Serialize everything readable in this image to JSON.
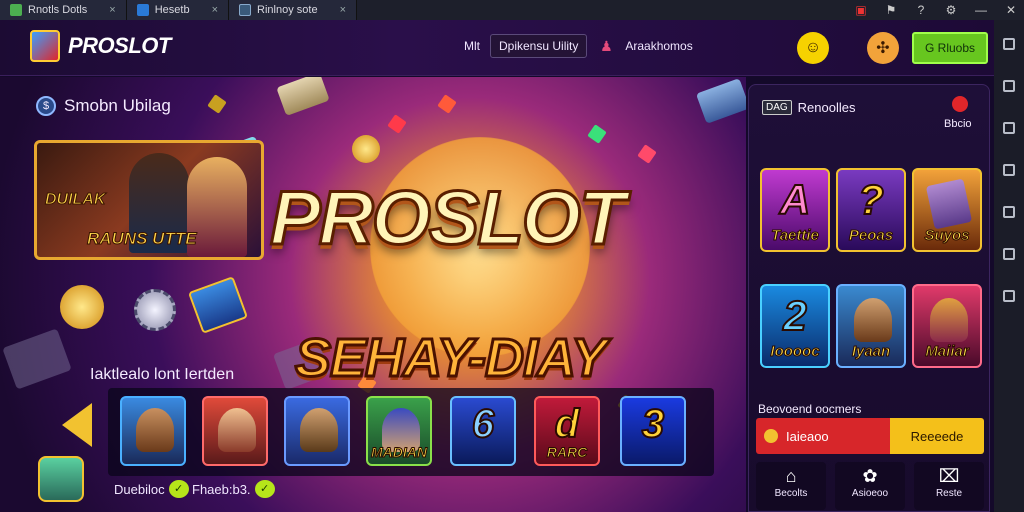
{
  "window": {
    "tabs": [
      {
        "label": "Rnotls Dotls",
        "icon": "folder-icon"
      },
      {
        "label": "Hesetb",
        "icon": "window-icon"
      },
      {
        "label": "Rinlnoy sote",
        "icon": "document-icon"
      }
    ],
    "controls": [
      "record-icon",
      "flag-icon",
      "help-icon",
      "gear-icon",
      "minimize-icon",
      "close-icon"
    ]
  },
  "header": {
    "logo": "PROSLOT",
    "nav_link": "Mlt",
    "nav_button": "Dpikensu Uility",
    "nav_account": "Araakhomos",
    "cta": "G Rluobs"
  },
  "hero": {
    "title": "PROSLOT",
    "subtitle": "SEHAY-DIAY",
    "left_section_title": "Smobn Ubilag",
    "promo_line1": "DUILAK",
    "promo_line2": "RAUNS UTTE",
    "row_title": "Iaktlealo lont Iertden",
    "row_tiles": [
      {
        "name": "tile-adventurer",
        "label": ""
      },
      {
        "name": "tile-heroine",
        "label": ""
      },
      {
        "name": "tile-explorer",
        "label": ""
      },
      {
        "name": "tile-police",
        "label": "MADIAN"
      },
      {
        "name": "tile-chip",
        "label": "6"
      },
      {
        "name": "tile-letter-d",
        "label": "RARC"
      },
      {
        "name": "tile-number-3",
        "label": "3"
      }
    ],
    "footer_item1": "Duebiloc",
    "footer_item2": "Fhaeb:b3."
  },
  "right_panel": {
    "tag": "DAG",
    "title": "Renoolles",
    "badge_label": "Bbcio",
    "tiles_row1": [
      {
        "big": "A",
        "label": "Taettie"
      },
      {
        "big": "?",
        "label": "Peoas"
      },
      {
        "big": "",
        "label": "Suyos"
      }
    ],
    "tiles_row2": [
      {
        "big": "2",
        "label": "Iooooc"
      },
      {
        "big": "",
        "label": "Iyaan"
      },
      {
        "big": "",
        "label": "Maiiar"
      }
    ],
    "deal_title": "Beovoend oocmers",
    "deal_left": "Iaieaoo",
    "deal_right": "Reeeede",
    "bottom_nav": [
      {
        "label": "Becolts",
        "icon": "home-icon"
      },
      {
        "label": "Asioeoo",
        "icon": "settings-icon"
      },
      {
        "label": "Reste",
        "icon": "store-icon"
      }
    ]
  }
}
